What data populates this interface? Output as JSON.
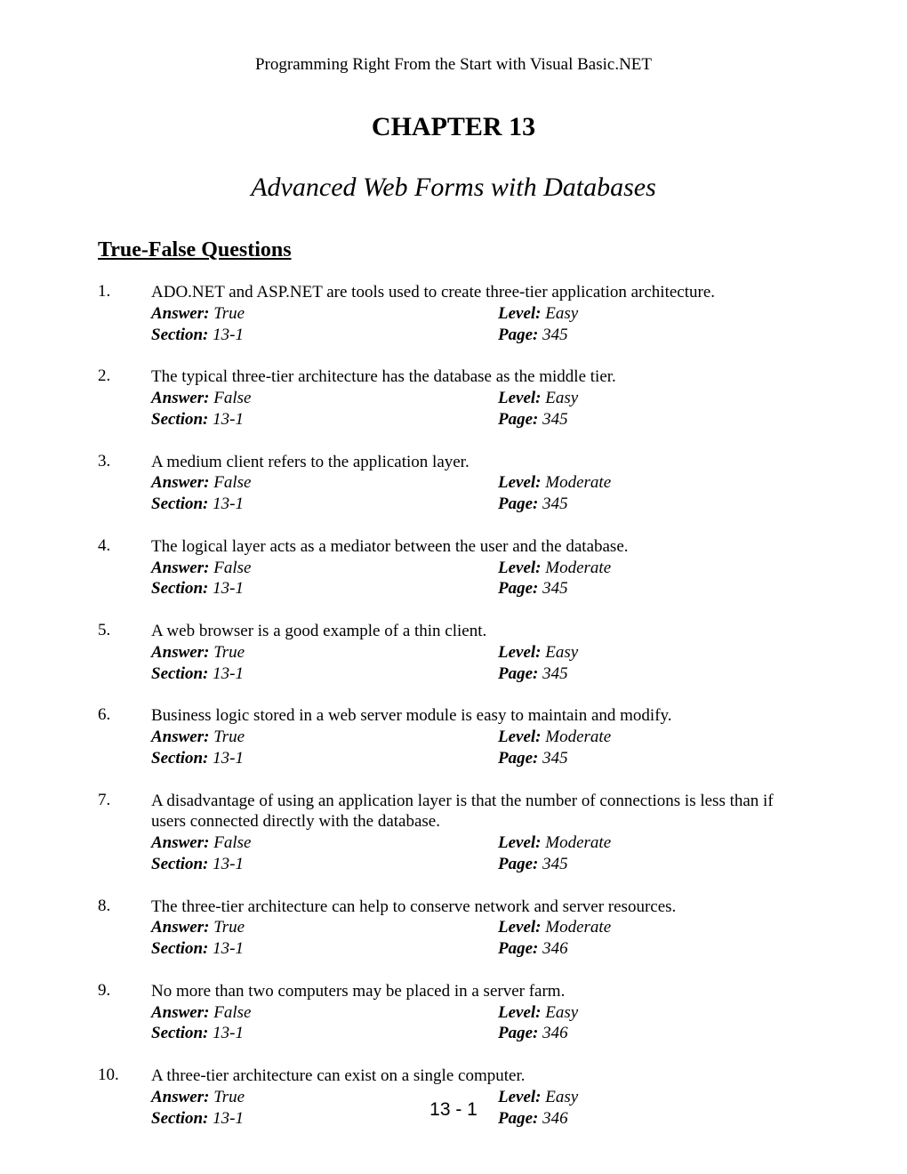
{
  "header": "Programming Right From the Start with Visual Basic.NET",
  "chapter_label": "CHAPTER 13",
  "chapter_title": "Advanced Web Forms with Databases",
  "section_heading": "True-False Questions",
  "labels": {
    "answer": "Answer:",
    "level": "Level:",
    "section": "Section:",
    "page": "Page:"
  },
  "questions": [
    {
      "num": "1.",
      "text": "ADO.NET and ASP.NET are tools used to create three-tier application architecture.",
      "answer": "True",
      "level": "Easy",
      "section": "13-1",
      "page": "345"
    },
    {
      "num": "2.",
      "text": "The typical three-tier architecture has the database as the middle tier.",
      "answer": "False",
      "level": "Easy",
      "section": "13-1",
      "page": "345"
    },
    {
      "num": "3.",
      "text": "A medium client refers to the application layer.",
      "answer": "False",
      "level": "Moderate",
      "section": "13-1",
      "page": "345"
    },
    {
      "num": "4.",
      "text": "The logical layer acts as a mediator between the user and the database.",
      "answer": "False",
      "level": "Moderate",
      "section": "13-1",
      "page": "345"
    },
    {
      "num": "5.",
      "text": "A web browser is a good example of a thin client.",
      "answer": "True",
      "level": "Easy",
      "section": "13-1",
      "page": "345"
    },
    {
      "num": "6.",
      "text": "Business logic stored in a web server module is easy to maintain and modify.",
      "answer": "True",
      "level": "Moderate",
      "section": "13-1",
      "page": "345"
    },
    {
      "num": "7.",
      "text": "A disadvantage of using an application layer is that the number of connections is less than if users connected directly with the database.",
      "answer": "False",
      "level": "Moderate",
      "section": "13-1",
      "page": "345"
    },
    {
      "num": "8.",
      "text": "The three-tier architecture can help to conserve network and server resources.",
      "answer": "True",
      "level": "Moderate",
      "section": "13-1",
      "page": "346"
    },
    {
      "num": "9.",
      "text": "No more than two computers may be placed in a server farm.",
      "answer": "False",
      "level": "Easy",
      "section": "13-1",
      "page": "346"
    },
    {
      "num": "10.",
      "text": "A three-tier architecture can exist on a single computer.",
      "answer": "True",
      "level": "Easy",
      "section": "13-1",
      "page": "346"
    }
  ],
  "footer": "13 - 1"
}
